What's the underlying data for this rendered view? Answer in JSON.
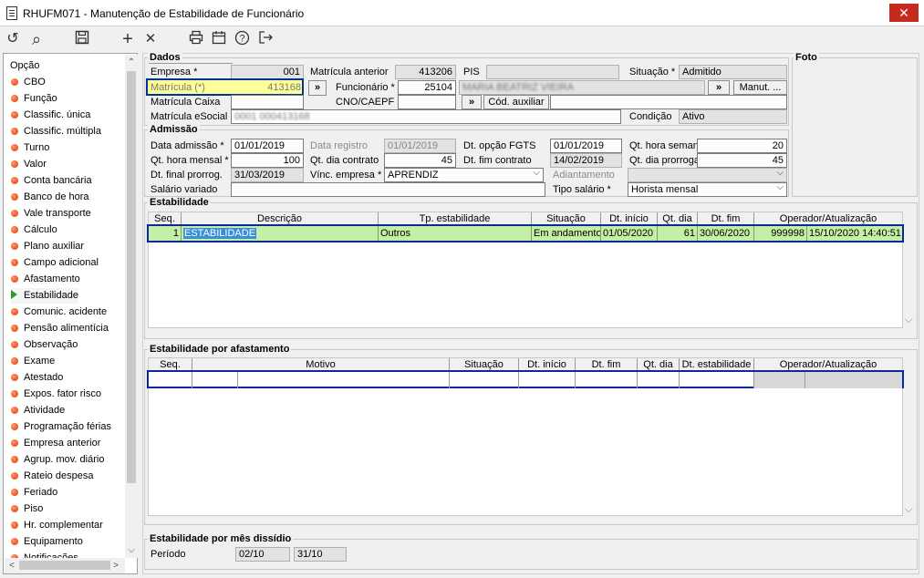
{
  "window": {
    "title": "RHUFM071 - Manutenção de Estabilidade de Funcionário",
    "close": "✕"
  },
  "toolbar": {
    "undo": "↺",
    "search": "⌕",
    "save": "💾",
    "add": "+",
    "remove": "✕",
    "print": "⎙",
    "calendar": "▦",
    "help": "?",
    "exit": "⇥"
  },
  "sidebar": {
    "header": "Opção",
    "items": [
      "CBO",
      "Função",
      "Classific. única",
      "Classific. múltipla",
      "Turno",
      "Valor",
      "Conta bancária",
      "Banco de hora",
      "Vale transporte",
      "Cálculo",
      "Plano auxiliar",
      "Campo adicional",
      "Afastamento",
      "Estabilidade",
      "Comunic. acidente",
      "Pensão alimentícia",
      "Observação",
      "Exame",
      "Atestado",
      "Expos. fator risco",
      "Atividade",
      "Programação férias",
      "Empresa anterior",
      "Agrup. mov. diário",
      "Rateio despesa",
      "Feriado",
      "Piso",
      "Hr. complementar",
      "Equipamento",
      "Notificações"
    ],
    "active": "Estabilidade"
  },
  "dados": {
    "title": "Dados",
    "empresa_label": "Empresa *",
    "empresa": "001",
    "matricula_ant_label": "Matrícula anterior",
    "matricula_ant": "413206",
    "pis_label": "PIS",
    "pis": "",
    "situacao_label": "Situação *",
    "situacao": "Admitido",
    "matricula_label": "Matrícula (*)",
    "matricula": "413168",
    "funcionario_label": "Funcionário *",
    "funcionario": "25104",
    "funcionario_nome": "MARIA BEATRIZ VIEIRA",
    "manut_btn": "Manut. ...",
    "matricula_caixa_label": "Matrícula Caixa",
    "matricula_caixa": "",
    "cno_label": "CNO/CAEPF",
    "cno": "",
    "cod_aux_btn": "Cód. auxiliar",
    "cod_aux": "",
    "matricula_esocial_label": "Matrícula eSocial",
    "matricula_esocial": "0001 000413168",
    "condicao_label": "Condição",
    "condicao": "Ativo",
    "nav": "»"
  },
  "foto": {
    "title": "Foto"
  },
  "admissao": {
    "title": "Admissão",
    "data_admissao_label": "Data admissão *",
    "data_admissao": "01/01/2019",
    "data_registro_label": "Data registro",
    "data_registro": "01/01/2019",
    "dt_opcao_fgts_label": "Dt. opção FGTS",
    "dt_opcao_fgts": "01/01/2019",
    "qt_hora_semanal_label": "Qt. hora semanal *",
    "qt_hora_semanal": "20",
    "qt_hora_mensal_label": "Qt. hora mensal *",
    "qt_hora_mensal": "100",
    "qt_dia_contrato_label": "Qt. dia contrato",
    "qt_dia_contrato": "45",
    "dt_fim_contrato_label": "Dt. fim contrato",
    "dt_fim_contrato": "14/02/2019",
    "qt_dia_prorrogado_label": "Qt. dia prorrogado",
    "qt_dia_prorrogado": "45",
    "dt_final_prorrog_label": "Dt. final prorrog.",
    "dt_final_prorrog": "31/03/2019",
    "vinc_empresa_label": "Vínc. empresa *",
    "vinc_empresa": "APRENDIZ",
    "adiantamento_label": "Adiantamento",
    "adiantamento": "",
    "salario_variado_label": "Salário variado",
    "salario_variado": "",
    "tipo_salario_label": "Tipo salário *",
    "tipo_salario": "Horista mensal"
  },
  "estabilidade": {
    "title": "Estabilidade",
    "columns": [
      "Seq.",
      "Descrição",
      "Tp. estabilidade",
      "Situação",
      "Dt. início",
      "Qt. dia",
      "Dt. fim",
      "Operador/Atualização"
    ],
    "row": {
      "seq": "1",
      "descricao": "ESTABILIDADE",
      "tipo": "Outros",
      "situacao": "Em andamento",
      "inicio": "01/05/2020",
      "qt_dia": "61",
      "fim": "30/06/2020",
      "operador": "999998",
      "atualizacao": "15/10/2020 14:40:51"
    }
  },
  "afastamento": {
    "title": "Estabilidade por afastamento",
    "columns": [
      "Seq.",
      "Motivo",
      "Situação",
      "Dt. início",
      "Dt. fim",
      "Qt. dia",
      "Dt. estabilidade",
      "Operador/Atualização"
    ]
  },
  "dissidio": {
    "title": "Estabilidade por mês dissídio",
    "periodo_label": "Período",
    "inicio": "02/10",
    "fim": "31/10"
  },
  "scroll": {
    "down": "⌵",
    "up": "⌃",
    "left": "<",
    "right": ">"
  }
}
